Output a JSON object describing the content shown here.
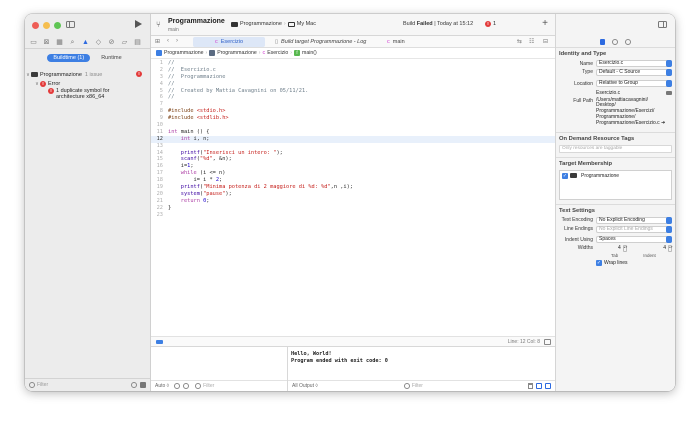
{
  "navigator": {
    "tabs": [
      "Buildtime (1)",
      "Runtime"
    ],
    "project": {
      "name": "Programmazione",
      "count": "1 issue"
    },
    "group": "Error",
    "issue_line1": "1 duplicate symbol for",
    "issue_line2": "architecture x86_64",
    "filter_placeholder": "Filter"
  },
  "toolbar": {
    "project_title": "Programmazione",
    "project_subtitle": "main",
    "scheme": "Programmazione",
    "destination": "My Mac",
    "status_prefix": "Build",
    "status_result": "Failed",
    "status_time": "| Today at 15:12",
    "error_count": "1"
  },
  "tabs": [
    {
      "label": "Esercizio"
    },
    {
      "label": "Build target Programmazione - Log"
    },
    {
      "label": "main"
    }
  ],
  "breadcrumbs": [
    "Programmazione",
    "Programmazione",
    "Esercizio",
    "main()"
  ],
  "code_lines": [
    {
      "n": "1",
      "segs": [
        {
          "t": "//",
          "c": "cm"
        }
      ]
    },
    {
      "n": "2",
      "segs": [
        {
          "t": "//  Esercizio.c",
          "c": "cm"
        }
      ]
    },
    {
      "n": "3",
      "segs": [
        {
          "t": "//  Programmazione",
          "c": "cm"
        }
      ]
    },
    {
      "n": "4",
      "segs": [
        {
          "t": "//",
          "c": "cm"
        }
      ]
    },
    {
      "n": "5",
      "segs": [
        {
          "t": "//  Created by Mattia Cavagnini on 05/11/21.",
          "c": "cm"
        }
      ]
    },
    {
      "n": "6",
      "segs": [
        {
          "t": "//",
          "c": "cm"
        }
      ]
    },
    {
      "n": "7",
      "segs": []
    },
    {
      "n": "8",
      "segs": [
        {
          "t": "#include ",
          "c": "pp"
        },
        {
          "t": "<stdio.h>",
          "c": "st"
        }
      ]
    },
    {
      "n": "9",
      "segs": [
        {
          "t": "#include ",
          "c": "pp"
        },
        {
          "t": "<stdlib.h>",
          "c": "st"
        }
      ]
    },
    {
      "n": "10",
      "segs": []
    },
    {
      "n": "11",
      "segs": [
        {
          "t": "int",
          "c": "kw"
        },
        {
          "t": " main () {",
          "c": ""
        }
      ]
    },
    {
      "n": "12",
      "current": true,
      "segs": [
        {
          "t": "    int",
          "c": "kw"
        },
        {
          "t": " i, n;",
          "c": ""
        }
      ]
    },
    {
      "n": "13",
      "segs": []
    },
    {
      "n": "14",
      "segs": [
        {
          "t": "    printf",
          "c": "fn"
        },
        {
          "t": "(",
          "c": ""
        },
        {
          "t": "\"Inserisci un intero: \"",
          "c": "st"
        },
        {
          "t": ");",
          "c": ""
        }
      ]
    },
    {
      "n": "15",
      "segs": [
        {
          "t": "    scanf",
          "c": "fn"
        },
        {
          "t": "(",
          "c": ""
        },
        {
          "t": "\"%d\"",
          "c": "st"
        },
        {
          "t": ", &n);",
          "c": ""
        }
      ]
    },
    {
      "n": "16",
      "segs": [
        {
          "t": "    i=",
          "c": ""
        },
        {
          "t": "1",
          "c": "nm"
        },
        {
          "t": ";",
          "c": ""
        }
      ]
    },
    {
      "n": "17",
      "segs": [
        {
          "t": "    while",
          "c": "kw"
        },
        {
          "t": " (i <= n)",
          "c": ""
        }
      ]
    },
    {
      "n": "18",
      "segs": [
        {
          "t": "        i= i * ",
          "c": ""
        },
        {
          "t": "2",
          "c": "nm"
        },
        {
          "t": ";",
          "c": ""
        }
      ]
    },
    {
      "n": "19",
      "segs": [
        {
          "t": "    printf",
          "c": "fn"
        },
        {
          "t": "(",
          "c": ""
        },
        {
          "t": "\"Minima potenza di 2 maggiore di %d: %d\"",
          "c": "st"
        },
        {
          "t": ",n ,i);",
          "c": ""
        }
      ]
    },
    {
      "n": "20",
      "segs": [
        {
          "t": "    system",
          "c": "fn"
        },
        {
          "t": "(",
          "c": ""
        },
        {
          "t": "\"pause\"",
          "c": "st"
        },
        {
          "t": ");",
          "c": ""
        }
      ]
    },
    {
      "n": "21",
      "segs": [
        {
          "t": "    return",
          "c": "kw"
        },
        {
          "t": " ",
          "c": ""
        },
        {
          "t": "0",
          "c": "nm"
        },
        {
          "t": ";",
          "c": ""
        }
      ]
    },
    {
      "n": "22",
      "segs": [
        {
          "t": "}",
          "c": ""
        }
      ]
    },
    {
      "n": "23",
      "segs": []
    }
  ],
  "editor_status": {
    "line_col": "Line: 12  Col: 8"
  },
  "debug": {
    "auto_label": "Auto ◊",
    "console_line1": "Hello, World!",
    "console_line2": "Program ended with exit code: 0",
    "output_label": "All Output ◊",
    "filter_placeholder": "Filter"
  },
  "inspector": {
    "identity_title": "Identity and Type",
    "name_label": "Name",
    "name_value": "Esercizio.c",
    "type_label": "Type",
    "type_value": "Default - C Source",
    "location_label": "Location",
    "location_value": "Relative to Group",
    "location_file": "Esercizio.c",
    "fullpath_label": "Full Path",
    "fullpath_lines": [
      "/Users/mattiacavagnini/",
      "Desktop/",
      "Programmazione/Esercizi/",
      "Programmazione/",
      "Programmazione/Esercizio.c"
    ],
    "ondemand_title": "On Demand Resource Tags",
    "ondemand_placeholder": "Only resources are taggable",
    "target_title": "Target Membership",
    "target_item": "Programmazione",
    "text_title": "Text Settings",
    "encoding_label": "Text Encoding",
    "encoding_value": "No Explicit Encoding",
    "endings_label": "Line Endings",
    "endings_value": "No Explicit Line Endings",
    "indent_label": "Indent Using",
    "indent_value": "Spaces",
    "widths_label": "Widths",
    "tab_width": "4",
    "indent_width": "4",
    "tab_caption": "Tab",
    "indent_caption": "Indent",
    "wrap_label": "Wrap lines"
  }
}
